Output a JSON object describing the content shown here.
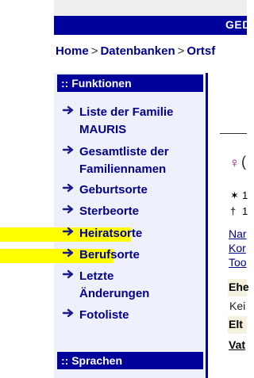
{
  "banner": {
    "text": "GED"
  },
  "breadcrumb": {
    "home": "Home",
    "sep": ">",
    "databases": "Datenbanken",
    "places": "Ortsf"
  },
  "sidebar": {
    "functions_header": ":: Funktionen",
    "languages_header": ":: Sprachen",
    "items": [
      {
        "label_lines": [
          "Liste der Familie",
          "MAURIS"
        ],
        "icon": "arrow-right-icon"
      },
      {
        "label_lines": [
          "Gesamtliste der",
          "Familiennamen"
        ],
        "icon": "arrow-right-icon"
      },
      {
        "label_lines": [
          "Geburtsorte"
        ],
        "icon": "arrow-right-icon"
      },
      {
        "label_lines": [
          "Sterbeorte"
        ],
        "icon": "arrow-right-icon"
      },
      {
        "label_lines": [
          "Heiratsorte"
        ],
        "icon": "arrow-right-icon",
        "highlighted": true
      },
      {
        "label_lines": [
          "Berufsorte"
        ],
        "icon": "arrow-right-icon",
        "highlighted": true
      },
      {
        "label_lines": [
          "Letzte",
          "Änderungen"
        ],
        "icon": "arrow-right-icon"
      },
      {
        "label_lines": [
          "Fotoliste"
        ],
        "icon": "arrow-right-icon"
      }
    ]
  },
  "content": {
    "gender_symbol": "♀",
    "paren": "(",
    "birth_symbol": "✶",
    "death_symbol": "†",
    "birth_value": "1",
    "death_value": "1",
    "links": [
      "Nar",
      "Kor",
      "Too"
    ],
    "ehe_label": "Ehe",
    "kei_text": "Kei",
    "elt_label": "Elt",
    "vat_label": "Vat"
  },
  "colors": {
    "navy": "#00009a",
    "link": "#00008b",
    "sidebar_bg": "#eef0fb",
    "highlight": "#ffff00",
    "beige": "#f5f1df"
  }
}
